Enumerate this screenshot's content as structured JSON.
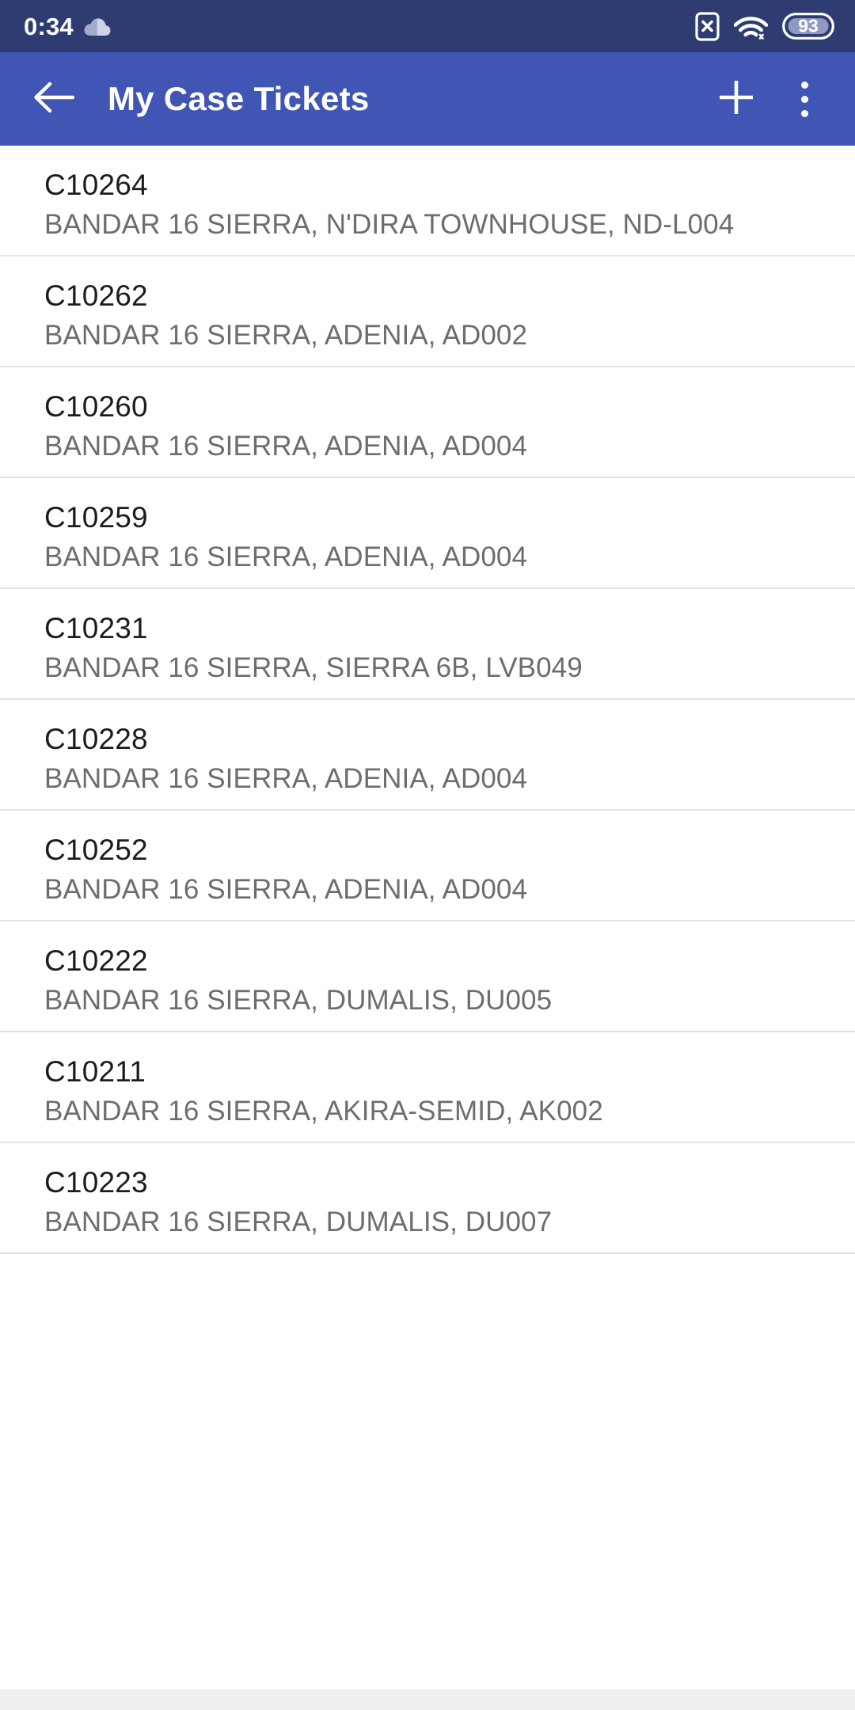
{
  "status_bar": {
    "time": "0:34",
    "weather_icon": "cloud-icon",
    "sim_icon": "sim-card-disabled-icon",
    "wifi_icon": "wifi-icon",
    "battery_level": "93",
    "background_color": "#2e3c72"
  },
  "app_bar": {
    "back_icon": "arrow-back-icon",
    "title": "My Case Tickets",
    "add_icon": "plus-icon",
    "overflow_icon": "more-vertical-icon",
    "background_color": "#4055b4"
  },
  "tickets": [
    {
      "id": "C10264",
      "address": "BANDAR 16 SIERRA, N'DIRA TOWNHOUSE, ND-L004"
    },
    {
      "id": "C10262",
      "address": "BANDAR 16 SIERRA, ADENIA, AD002"
    },
    {
      "id": "C10260",
      "address": "BANDAR 16 SIERRA, ADENIA, AD004"
    },
    {
      "id": "C10259",
      "address": "BANDAR 16 SIERRA, ADENIA, AD004"
    },
    {
      "id": "C10231",
      "address": "BANDAR 16 SIERRA, SIERRA 6B, LVB049"
    },
    {
      "id": "C10228",
      "address": "BANDAR 16 SIERRA, ADENIA, AD004"
    },
    {
      "id": "C10252",
      "address": "BANDAR 16 SIERRA, ADENIA, AD004"
    },
    {
      "id": "C10222",
      "address": "BANDAR 16 SIERRA, DUMALIS, DU005"
    },
    {
      "id": "C10211",
      "address": "BANDAR 16 SIERRA, AKIRA-SEMID, AK002"
    },
    {
      "id": "C10223",
      "address": "BANDAR 16 SIERRA, DUMALIS, DU007"
    }
  ]
}
